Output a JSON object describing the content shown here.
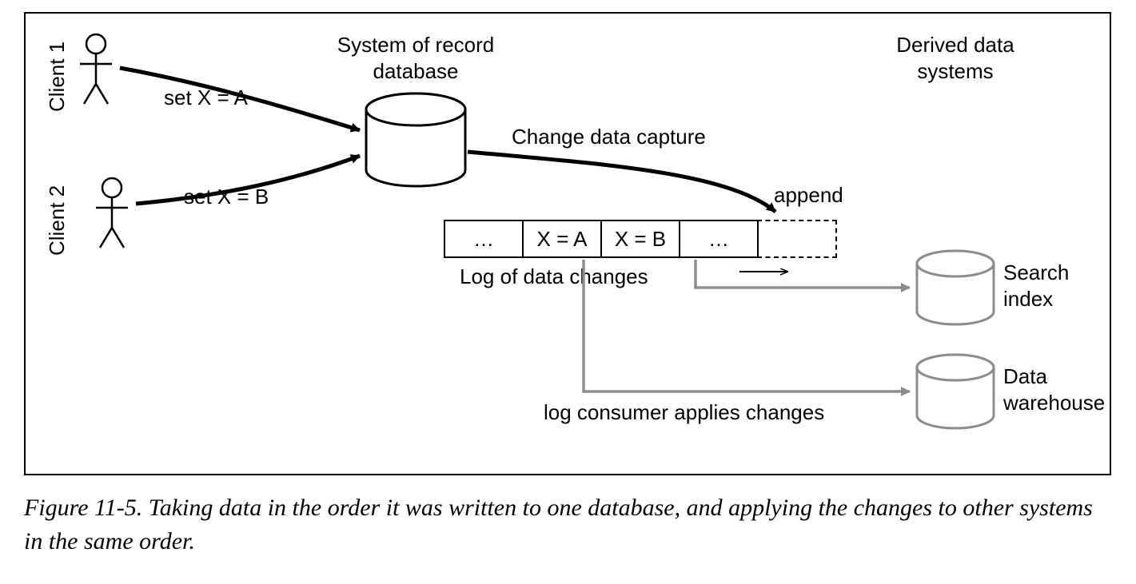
{
  "clients": {
    "client1_label": "Client 1",
    "client2_label": "Client 2",
    "client1_action": "set X = A",
    "client2_action": "set X = B"
  },
  "system_of_record": {
    "title_line1": "System of record",
    "title_line2": "database"
  },
  "cdc_label": "Change data capture",
  "append_label": "append",
  "log": {
    "cell1": "…",
    "cell2": "X = A",
    "cell3": "X = B",
    "cell4": "…",
    "caption": "Log of data changes"
  },
  "consumer_label": "log consumer applies changes",
  "derived": {
    "title_line1": "Derived data",
    "title_line2": "systems",
    "search_line1": "Search",
    "search_line2": "index",
    "dw_line1": "Data",
    "dw_line2": "warehouse"
  },
  "caption": "Figure 11-5. Taking data in the order it was written to one database, and applying the changes to other systems in the same order."
}
